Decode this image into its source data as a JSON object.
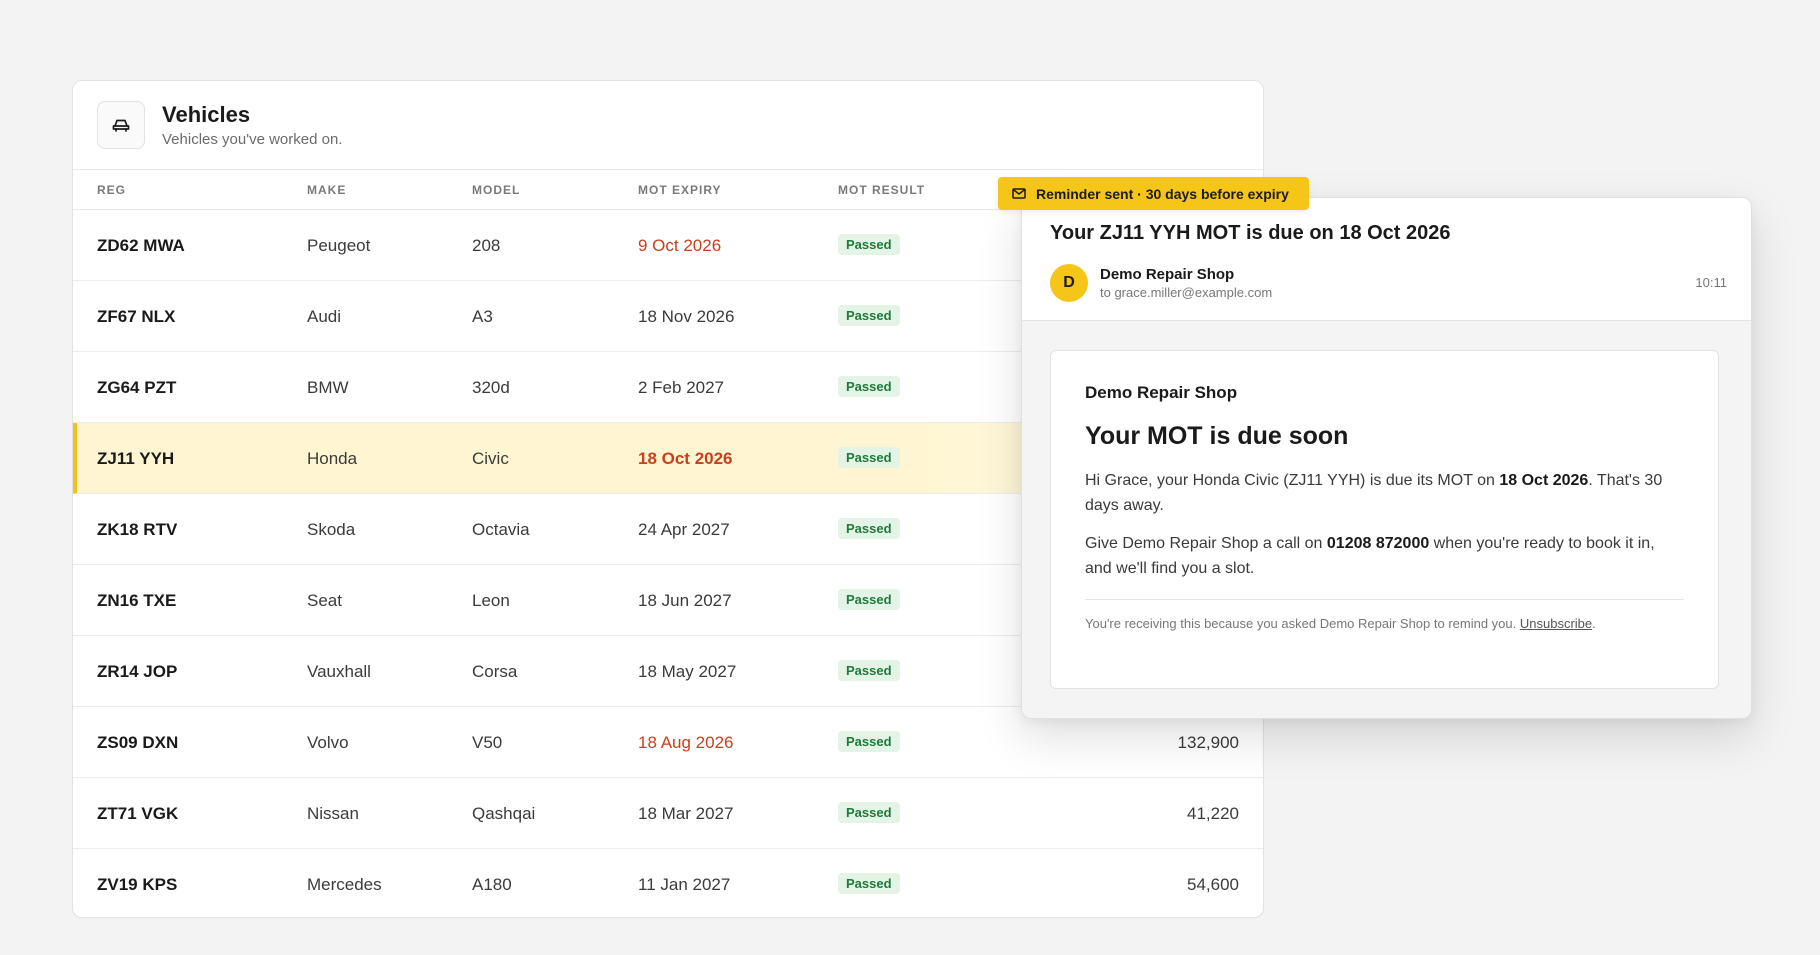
{
  "vehicles_panel": {
    "title": "Vehicles",
    "subtitle": "Vehicles you've worked on.",
    "icon": "car-icon",
    "columns": {
      "reg": "REG",
      "make": "MAKE",
      "model": "MODEL",
      "mot_expiry": "MOT EXPIRY",
      "mot_result": "MOT RESULT"
    },
    "rows": [
      {
        "reg": "ZD62 MWA",
        "make": "Peugeot",
        "model": "208",
        "mot_expiry": "9 Oct 2026",
        "mot_result": "Passed",
        "mileage": ""
      },
      {
        "reg": "ZF67 NLX",
        "make": "Audi",
        "model": "A3",
        "mot_expiry": "18 Nov 2026",
        "mot_result": "Passed",
        "mileage": ""
      },
      {
        "reg": "ZG64 PZT",
        "make": "BMW",
        "model": "320d",
        "mot_expiry": "2 Feb 2027",
        "mot_result": "Passed",
        "mileage": ""
      },
      {
        "reg": "ZJ11 YYH",
        "make": "Honda",
        "model": "Civic",
        "mot_expiry": "18 Oct 2026",
        "mot_result": "Passed",
        "mileage": ""
      },
      {
        "reg": "ZK18 RTV",
        "make": "Skoda",
        "model": "Octavia",
        "mot_expiry": "24 Apr 2027",
        "mot_result": "Passed",
        "mileage": ""
      },
      {
        "reg": "ZN16 TXE",
        "make": "Seat",
        "model": "Leon",
        "mot_expiry": "18 Jun 2027",
        "mot_result": "Passed",
        "mileage": ""
      },
      {
        "reg": "ZR14 JOP",
        "make": "Vauxhall",
        "model": "Corsa",
        "mot_expiry": "18 May 2027",
        "mot_result": "Passed",
        "mileage": ""
      },
      {
        "reg": "ZS09 DXN",
        "make": "Volvo",
        "model": "V50",
        "mot_expiry": "18 Aug 2026",
        "mot_result": "Passed",
        "mileage": "132,900"
      },
      {
        "reg": "ZT71 VGK",
        "make": "Nissan",
        "model": "Qashqai",
        "mot_expiry": "18 Mar 2027",
        "mot_result": "Passed",
        "mileage": "41,220"
      },
      {
        "reg": "ZV19 KPS",
        "make": "Mercedes",
        "model": "A180",
        "mot_expiry": "11 Jan 2027",
        "mot_result": "Passed",
        "mileage": "54,600"
      }
    ]
  },
  "reminder_tag": {
    "label": "Reminder sent · 30 days before expiry",
    "icon": "mail-icon"
  },
  "email": {
    "subject": "Your ZJ11 YYH MOT is due on 18 Oct 2026",
    "avatar_letter": "D",
    "sender_name": "Demo Repair Shop",
    "recipient": "to grace.miller@example.com",
    "time": "10:11",
    "card": {
      "brand": "Demo Repair Shop",
      "heading": "Your MOT is due soon",
      "para1_before": "Hi Grace, your Honda Civic (ZJ11 YYH) is due its MOT on ",
      "para1_bold": "18 Oct 2026",
      "para1_after": ". That's 30 days away.",
      "para2_before": "Give Demo Repair Shop a call on ",
      "para2_bold": "01208 872000",
      "para2_after": " when you're ready to book it in, and we'll find you a slot.",
      "footer_text": "You're receiving this because you asked Demo Repair Shop to remind you. ",
      "unsubscribe_label": "Unsubscribe",
      "footer_end": "."
    }
  },
  "colors": {
    "accent_yellow": "#f5c518",
    "warning_red": "#c8401c",
    "passed_green": "#1f7a3a",
    "passed_bg": "#e3f4e7",
    "highlight_bg": "#fff5d2"
  }
}
